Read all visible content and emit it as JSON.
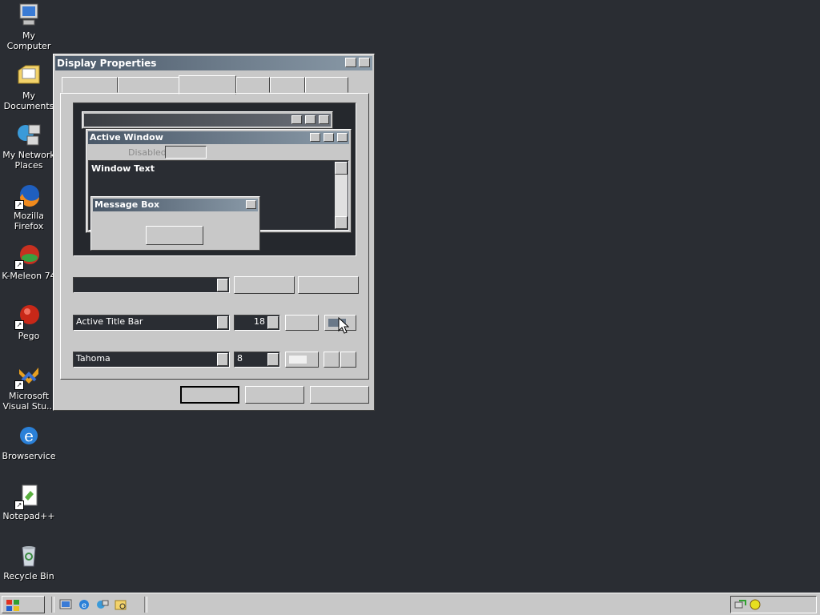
{
  "desktop": {
    "icons": [
      {
        "label": "My Computer",
        "icon": "computer-icon"
      },
      {
        "label": "My Documents",
        "icon": "folder-icon"
      },
      {
        "label": "My Network Places",
        "icon": "network-icon"
      },
      {
        "label": "Mozilla Firefox",
        "icon": "firefox-icon"
      },
      {
        "label": "K-Meleon 74",
        "icon": "kmeleon-icon"
      },
      {
        "label": "Pego",
        "icon": "pego-icon"
      },
      {
        "label": "Microsoft Visual Stu...",
        "icon": "visual-studio-icon"
      },
      {
        "label": "Browservice",
        "icon": "ie-icon"
      },
      {
        "label": "Notepad++",
        "icon": "notepad-icon"
      },
      {
        "label": "Recycle Bin",
        "icon": "recycle-bin-icon"
      }
    ]
  },
  "window": {
    "title": "Display Properties",
    "preview": {
      "active_window_title": "Active Window",
      "disabled_label": "Disabled",
      "window_text": "Window Text",
      "message_box_title": "Message Box"
    },
    "item_select": {
      "value": "Active Title Bar"
    },
    "size_value": "18",
    "font_select": {
      "value": "Tahoma"
    },
    "font_size_value": "8"
  },
  "colors": {
    "desktop": "#2a2d33",
    "title_gradient_start": "#4a5868",
    "title_gradient_end": "#8a9aa8",
    "face": "#c8c8c8"
  }
}
